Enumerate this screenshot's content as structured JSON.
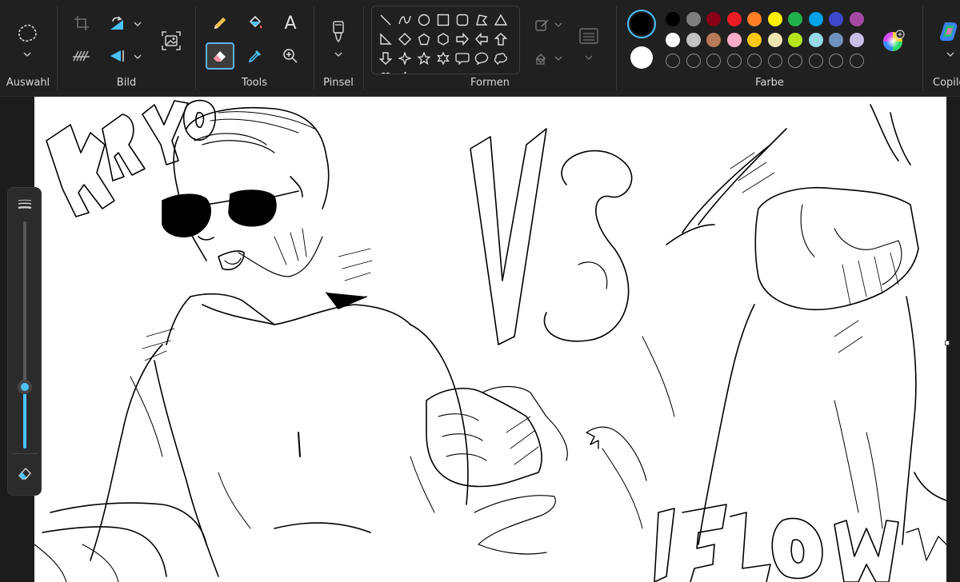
{
  "ribbon": {
    "groups": {
      "selection": "Auswahl",
      "image": "Bild",
      "tools": "Tools",
      "brushes": "Pinsel",
      "shapes": "Formen",
      "colors": "Farbe",
      "copilot": "Copilo"
    },
    "icons": {
      "selection": "freeform-selection-icon",
      "crop": "crop-icon",
      "rotate": "rotate-icon",
      "resize": "resize-icon",
      "flip": "flip-icon",
      "image_creator": "image-creator-icon",
      "pencil": "pencil-icon",
      "fill": "fill-bucket-icon",
      "text": "text-icon",
      "eraser": "eraser-icon",
      "color_picker": "color-picker-icon",
      "magnifier": "magnifier-icon",
      "brush": "brush-icon",
      "outline": "shape-outline-icon",
      "shape_fill": "shape-fill-icon",
      "layers": "layers-icon",
      "edit_colors": "edit-colors-icon",
      "copilot": "copilot-icon"
    },
    "text_tool_glyph": "A",
    "shapes": [
      "line",
      "curve",
      "oval",
      "rectangle",
      "rounded-rectangle",
      "polygon",
      "triangle",
      "right-triangle",
      "diamond",
      "pentagon",
      "hexagon",
      "right-arrow",
      "left-arrow",
      "up-arrow",
      "down-arrow",
      "four-point-star",
      "five-point-star",
      "six-point-star",
      "rounded-callout",
      "oval-callout",
      "cloud-callout",
      "heart",
      "lightning"
    ],
    "colors": {
      "color1": "#000000",
      "color2": "#ffffff",
      "palette_row1": [
        "#000000",
        "#7f7f7f",
        "#880015",
        "#ed1c24",
        "#ff7f27",
        "#fff200",
        "#22b14c",
        "#00a2e8",
        "#3f48cc",
        "#a349a4"
      ],
      "palette_row2": [
        "#ffffff",
        "#c3c3c3",
        "#b97a57",
        "#ffaec9",
        "#ffc90e",
        "#efe4b0",
        "#b5e61d",
        "#99d9ea",
        "#7092be",
        "#c8bfe7"
      ],
      "custom_slots": 10
    }
  },
  "brush_size": {
    "level": 0.27
  },
  "canvas": {
    "drawing_text_left": "KRYO",
    "drawing_text_center": "VS",
    "drawing_text_bottom": "FLOW"
  }
}
